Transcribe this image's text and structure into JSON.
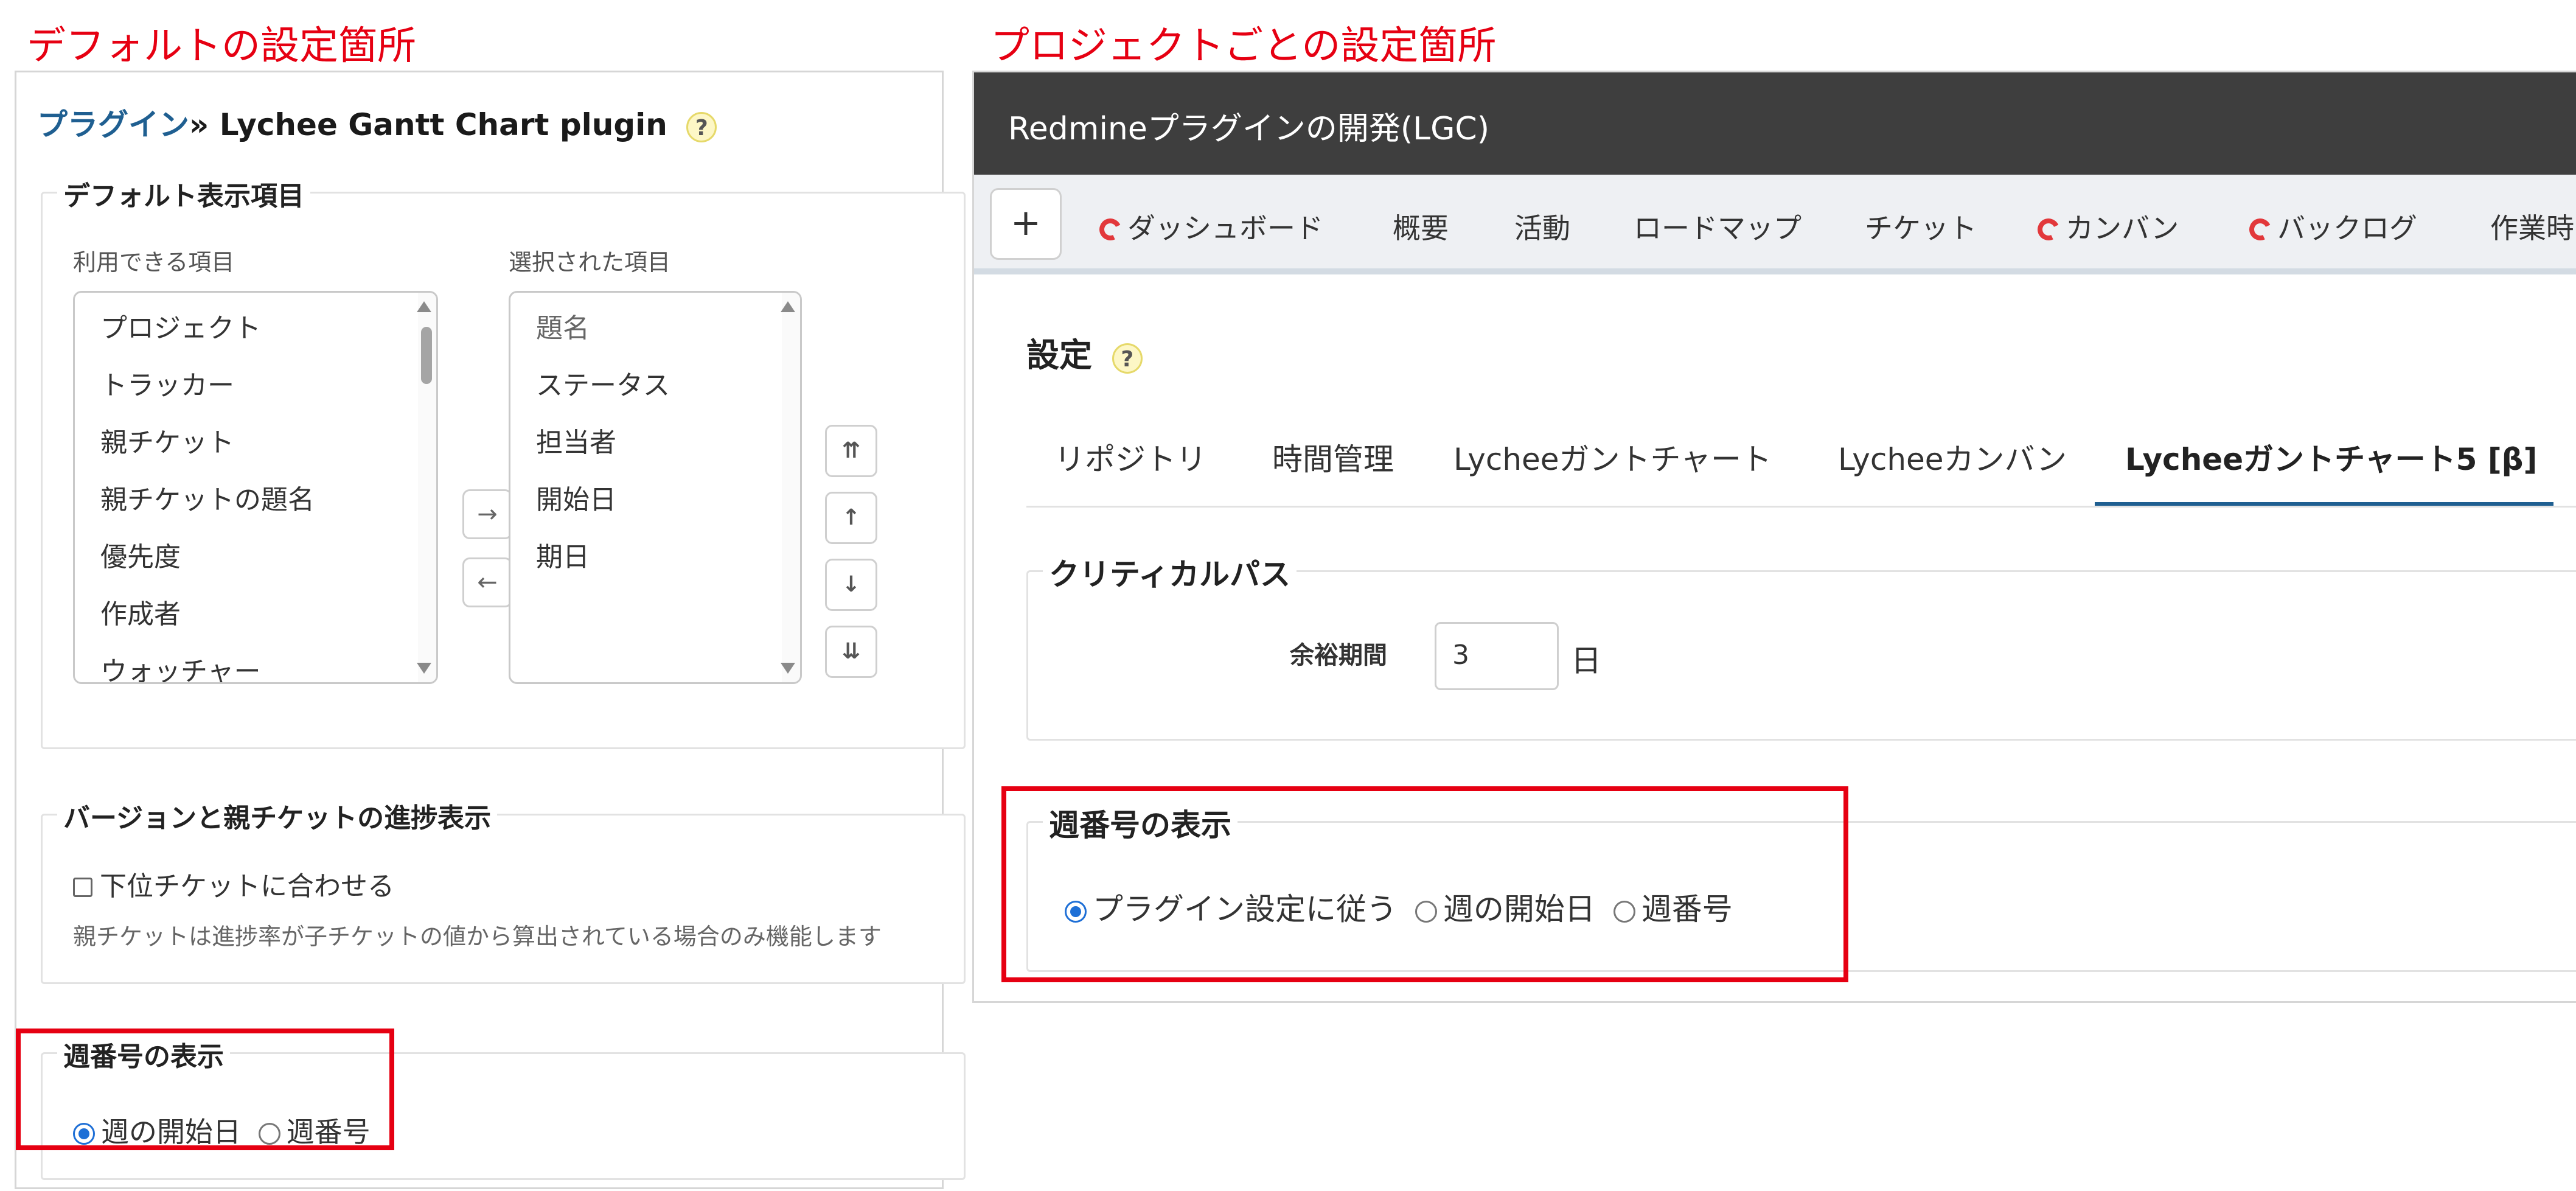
{
  "captions": {
    "default": "デフォルトの設定箇所",
    "project": "プロジェクトごとの設定箇所"
  },
  "plugin_settings": {
    "breadcrumb": "プラグイン",
    "separator": "»",
    "plugin_name": "Lychee Gantt Chart plugin",
    "help": "?",
    "default_columns": {
      "legend": "デフォルト表示項目",
      "available_label": "利用できる項目",
      "selected_label": "選択された項目",
      "available": [
        "プロジェクト",
        "トラッカー",
        "親チケット",
        "親チケットの題名",
        "優先度",
        "作成者",
        "ウォッチャー"
      ],
      "selected": [
        "題名",
        "ステータス",
        "担当者",
        "開始日",
        "期日"
      ],
      "add_label": "→",
      "remove_label": "←",
      "top_label": "⇈",
      "up_label": "↑",
      "down_label": "↓",
      "bottom_label": "⇊"
    },
    "progress": {
      "legend": "バージョンと親チケットの進捗表示",
      "checkbox_label": "下位チケットに合わせる",
      "note": "親チケットは進捗率が子チケットの値から算出されている場合のみ機能します"
    },
    "week_number": {
      "legend": "週番号の表示",
      "options": [
        "週の開始日",
        "週番号"
      ],
      "selected_index": 0
    }
  },
  "project_settings": {
    "project_title": "Redmineプラグインの開発(LGC)",
    "new_button": "+",
    "menu": [
      {
        "label": "ダッシュボード",
        "icon": "lychee-icon"
      },
      {
        "label": "概要"
      },
      {
        "label": "活動"
      },
      {
        "label": "ロードマップ"
      },
      {
        "label": "チケット"
      },
      {
        "label": "カンバン",
        "icon": "lychee-icon"
      },
      {
        "label": "バックログ",
        "icon": "lychee-icon"
      },
      {
        "label": "作業時"
      }
    ],
    "heading": "設定",
    "help": "?",
    "tabs": [
      "リポジトリ",
      "時間管理",
      "Lycheeガントチャート",
      "Lycheeカンバン",
      "Lycheeガントチャート5 [β]"
    ],
    "active_tab_index": 4,
    "critical_path": {
      "legend": "クリティカルパス",
      "slack_label": "余裕期間",
      "slack_value": "3",
      "unit": "日"
    },
    "week_number": {
      "legend": "週番号の表示",
      "options": [
        "プラグイン設定に従う",
        "週の開始日",
        "週番号"
      ],
      "selected_index": 0
    }
  },
  "colors": {
    "caption": "#e60012",
    "highlight_box": "#e60012",
    "header_bg": "#3e3e3e",
    "link": "#1f5f91",
    "radio_selected": "#1e6fd6",
    "lychee_icon": "#e2383b"
  }
}
